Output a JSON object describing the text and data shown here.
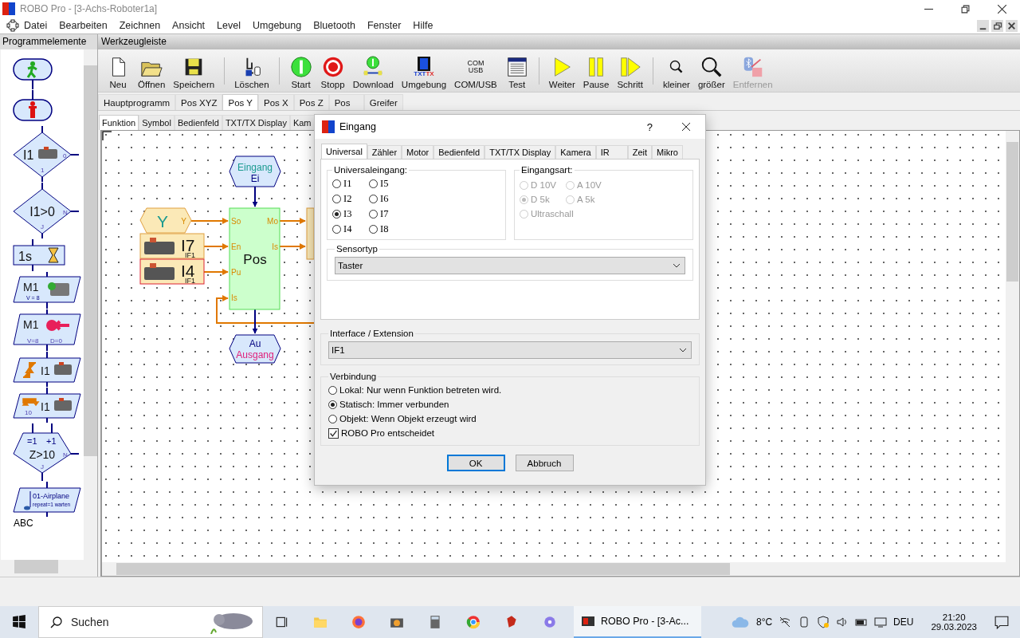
{
  "window": {
    "title": "ROBO Pro - [3-Achs-Roboter1a]"
  },
  "menu": [
    "Datei",
    "Bearbeiten",
    "Zeichnen",
    "Ansicht",
    "Level",
    "Umgebung",
    "Bluetooth",
    "Fenster",
    "Hilfe"
  ],
  "palette": {
    "title": "Programmelemente",
    "items": [
      {
        "kind": "start"
      },
      {
        "kind": "end"
      },
      {
        "kind": "branch",
        "label": "I1",
        "no": "0",
        "yes": "1"
      },
      {
        "kind": "compare",
        "label": "I1>0",
        "no": "N",
        "yes": "J"
      },
      {
        "kind": "wait",
        "label": "1s"
      },
      {
        "kind": "motor",
        "label": "M1",
        "sub": "V = 8"
      },
      {
        "kind": "motor_stop",
        "label": "M1",
        "speed": "V=8",
        "dist": "D=0"
      },
      {
        "kind": "edge",
        "label": "I1"
      },
      {
        "kind": "pulse",
        "label": "I1",
        "count": "10"
      },
      {
        "kind": "loop",
        "set": "=1",
        "inc": "+1",
        "label": "Z>10",
        "no": "N",
        "yes": "J"
      },
      {
        "kind": "sound",
        "label": "01-Airplane",
        "sub": "repeat=1 warten"
      },
      {
        "kind": "text",
        "label": "ABC"
      }
    ]
  },
  "toolbar": {
    "title": "Werkzeugleiste",
    "groups": [
      [
        {
          "label": "Neu",
          "kind": "new",
          "disabled": false
        },
        {
          "label": "Öffnen",
          "kind": "open",
          "disabled": false
        },
        {
          "label": "Speichern",
          "kind": "save",
          "disabled": false
        }
      ],
      [
        {
          "label": "Löschen",
          "kind": "delete",
          "disabled": false
        }
      ],
      [
        {
          "label": "Start",
          "kind": "start",
          "disabled": false
        },
        {
          "label": "Stopp",
          "kind": "stop",
          "disabled": false
        },
        {
          "label": "Download",
          "kind": "download",
          "disabled": false
        },
        {
          "label": "Umgebung",
          "kind": "environment",
          "icon_text": [
            "TXT",
            "TX"
          ],
          "disabled": false
        },
        {
          "label": "COM/USB",
          "kind": "port",
          "icon_text": [
            "COM",
            "USB"
          ],
          "disabled": false
        },
        {
          "label": "Test",
          "kind": "test",
          "disabled": false
        }
      ],
      [
        {
          "label": "Weiter",
          "kind": "play",
          "disabled": false
        },
        {
          "label": "Pause",
          "kind": "pause",
          "disabled": false
        },
        {
          "label": "Schritt",
          "kind": "step",
          "disabled": false
        }
      ],
      [
        {
          "label": "kleiner",
          "kind": "zoom_small",
          "disabled": false
        },
        {
          "label": "größer",
          "kind": "zoom_large",
          "disabled": false
        },
        {
          "label": "Entfernen",
          "kind": "bt_remove",
          "disabled": true
        }
      ]
    ]
  },
  "program_tabs": [
    {
      "label": "Hauptprogramm",
      "selected": false
    },
    {
      "label": "Pos XYZ",
      "selected": false
    },
    {
      "label": "Pos Y",
      "selected": true
    },
    {
      "label": "Pos X",
      "selected": false
    },
    {
      "label": "Pos Z",
      "selected": false
    },
    {
      "label": "Pos",
      "selected": false
    },
    {
      "label": "Greifer",
      "selected": false
    }
  ],
  "view_tabs": [
    {
      "label": "Funktion",
      "selected": true
    },
    {
      "label": "Symbol",
      "selected": false
    },
    {
      "label": "Bedienfeld",
      "selected": false
    },
    {
      "label": "TXT/TX Display",
      "selected": false
    },
    {
      "label": "Kam",
      "selected": false
    }
  ],
  "diagram": {
    "input": {
      "label": "Eingang",
      "name": "Ei"
    },
    "output": {
      "name": "Au",
      "label": "Ausgang"
    },
    "function": {
      "label": "Pos",
      "ports_in": [
        "So",
        "En",
        "Pu",
        "Is"
      ],
      "ports_out": [
        "Mo",
        "Is"
      ]
    },
    "variable": {
      "label": "Y",
      "port": "Y"
    },
    "sensors": [
      {
        "label": "I7",
        "interface": "IF1",
        "selected": false
      },
      {
        "label": "I4",
        "interface": "IF1",
        "selected": true
      }
    ],
    "motor_block": {
      "kind": "block"
    }
  },
  "dialog": {
    "title": "Eingang",
    "help": "?",
    "tabs": [
      {
        "label": "Universal",
        "selected": true
      },
      {
        "label": "Zähler",
        "selected": false
      },
      {
        "label": "Motor",
        "selected": false
      },
      {
        "label": "Bedienfeld",
        "selected": false
      },
      {
        "label": "TXT/TX Display",
        "selected": false
      },
      {
        "label": "Kamera",
        "selected": false
      },
      {
        "label": "IR",
        "selected": false
      },
      {
        "label": "Zeit",
        "selected": false
      },
      {
        "label": "Mikro",
        "selected": false
      }
    ],
    "inputs_title": "Universaleingang:",
    "inputs": [
      {
        "label": "I1",
        "selected": false
      },
      {
        "label": "I2",
        "selected": false
      },
      {
        "label": "I3",
        "selected": true
      },
      {
        "label": "I4",
        "selected": false
      },
      {
        "label": "I5",
        "selected": false
      },
      {
        "label": "I6",
        "selected": false
      },
      {
        "label": "I7",
        "selected": false
      },
      {
        "label": "I8",
        "selected": false
      }
    ],
    "mode_title": "Eingangsart:",
    "modes": [
      {
        "label": "D 10V",
        "selected": false,
        "disabled": true
      },
      {
        "label": "A 10V",
        "selected": false,
        "disabled": true
      },
      {
        "label": "D 5k",
        "selected": true,
        "disabled": true
      },
      {
        "label": "A 5k",
        "selected": false,
        "disabled": true
      },
      {
        "label": "Ultraschall",
        "selected": false,
        "disabled": true
      }
    ],
    "sensor_title": "Sensortyp",
    "sensor_value": "Taster",
    "interface_title": "Interface / Extension",
    "interface_value": "IF1",
    "connection_title": "Verbindung",
    "connections": [
      {
        "label": "Lokal: Nur wenn Funktion betreten wird.",
        "selected": false
      },
      {
        "label": "Statisch: Immer verbunden",
        "selected": true
      },
      {
        "label": "Objekt: Wenn Objekt erzeugt wird",
        "selected": false
      }
    ],
    "auto": {
      "label": "ROBO Pro entscheidet",
      "checked": true
    },
    "buttons": [
      "OK",
      "Abbruch"
    ]
  },
  "taskbar": {
    "search_placeholder": "Suchen",
    "app": "ROBO Pro - [3-Ac...",
    "temperature": "8°C",
    "language": "DEU",
    "time": "21:20",
    "date": "29.03.2023"
  }
}
